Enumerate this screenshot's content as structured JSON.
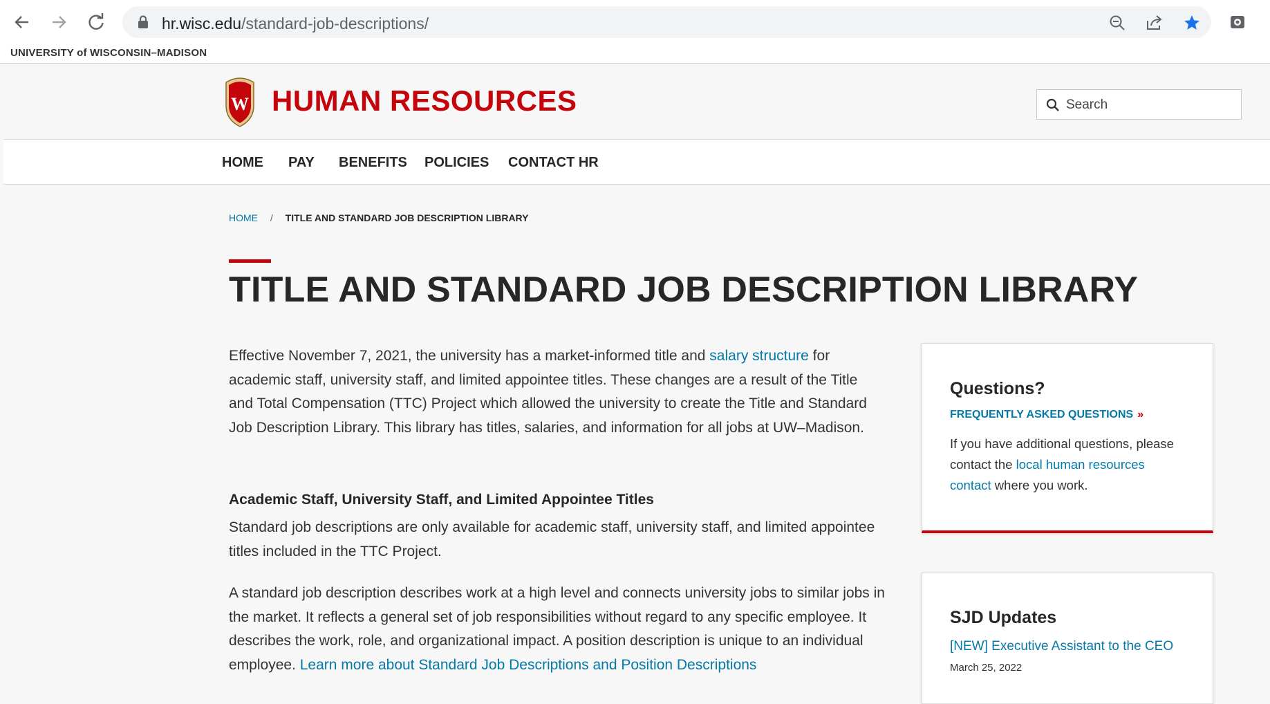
{
  "browser": {
    "url_domain": "hr.wisc.edu",
    "url_path": "/standard-job-descriptions/"
  },
  "uw_bar": {
    "label": "UNIVERSITY of WISCONSIN–MADISON"
  },
  "header": {
    "site_title": "HUMAN RESOURCES",
    "crest_letter": "W",
    "search_placeholder": "Search"
  },
  "nav": {
    "items": [
      {
        "label": "HOME"
      },
      {
        "label": "PAY"
      },
      {
        "label": "BENEFITS"
      },
      {
        "label": "POLICIES"
      },
      {
        "label": "CONTACT HR"
      }
    ]
  },
  "breadcrumb": {
    "home": "HOME",
    "separator": "/",
    "current": "TITLE AND STANDARD JOB DESCRIPTION LIBRARY"
  },
  "page": {
    "title": "TITLE AND STANDARD JOB DESCRIPTION LIBRARY",
    "p1_before": "Effective November 7, 2021, the university has a market-informed title and ",
    "p1_link": "salary structure",
    "p1_after": " for academic staff, university staff, and limited appointee titles. These changes are a result of the Title and Total Compensation (TTC) Project which allowed the university to create the Title and Standard Job Description Library. This library has titles, salaries, and information for all jobs at UW–Madison.",
    "subheading": "Academic Staff, University Staff, and Limited Appointee Titles",
    "p2": "Standard job descriptions are only available for academic staff, university staff, and limited appointee titles included in the TTC Project.",
    "p3_before": "A standard job description describes work at a high level and connects university jobs to similar jobs in the market. It reflects a general set of job responsibilities without regard to any specific employee. It describes the work, role, and organizational impact. A position description is unique to an individual employee. ",
    "p3_link": "Learn more about Standard Job Descriptions and Position Descriptions"
  },
  "sidebar": {
    "questions": {
      "heading": "Questions?",
      "faq_link": "FREQUENTLY ASKED QUESTIONS",
      "faq_chevron": "»",
      "text_before": "If you have additional questions, please contact the ",
      "text_link": "local human resources contact",
      "text_after": " where you work."
    },
    "updates": {
      "heading": "SJD Updates",
      "item_link": "[NEW] Executive Assistant to the CEO",
      "item_date": "March 25, 2022"
    }
  },
  "colors": {
    "brand_red": "#c5050c",
    "link_blue": "#0479a8",
    "text": "#282728"
  }
}
